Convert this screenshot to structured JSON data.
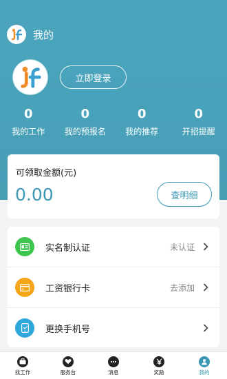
{
  "header": {
    "title": "我的"
  },
  "profile": {
    "login_label": "立即登录"
  },
  "stats": [
    {
      "value": "0",
      "label": "我的工作"
    },
    {
      "value": "0",
      "label": "我的预报名"
    },
    {
      "value": "0",
      "label": "我的推荐"
    },
    {
      "value": "0",
      "label": "开招提醒"
    }
  ],
  "balance": {
    "label": "可领取金额(元)",
    "value": "0.00",
    "detail_label": "查明细"
  },
  "menu": [
    {
      "label": "实名制认证",
      "status": "未认证",
      "icon": "id-card-icon",
      "color": "#3fc44e"
    },
    {
      "label": "工资银行卡",
      "status": "去添加",
      "icon": "bank-card-icon",
      "color": "#f5a515"
    },
    {
      "label": "更换手机号",
      "status": "",
      "icon": "phone-icon",
      "color": "#2ea7d9"
    }
  ],
  "tabs": [
    {
      "label": "找工作",
      "icon": "briefcase-icon"
    },
    {
      "label": "服务台",
      "icon": "heart-icon"
    },
    {
      "label": "消息",
      "icon": "chat-icon"
    },
    {
      "label": "奖励",
      "icon": "yen-icon"
    },
    {
      "label": "我的",
      "icon": "person-icon",
      "active": true
    }
  ],
  "colors": {
    "brand": "#4aa5bd",
    "accent": "#3b98b4",
    "background": "#f3f3f3"
  }
}
